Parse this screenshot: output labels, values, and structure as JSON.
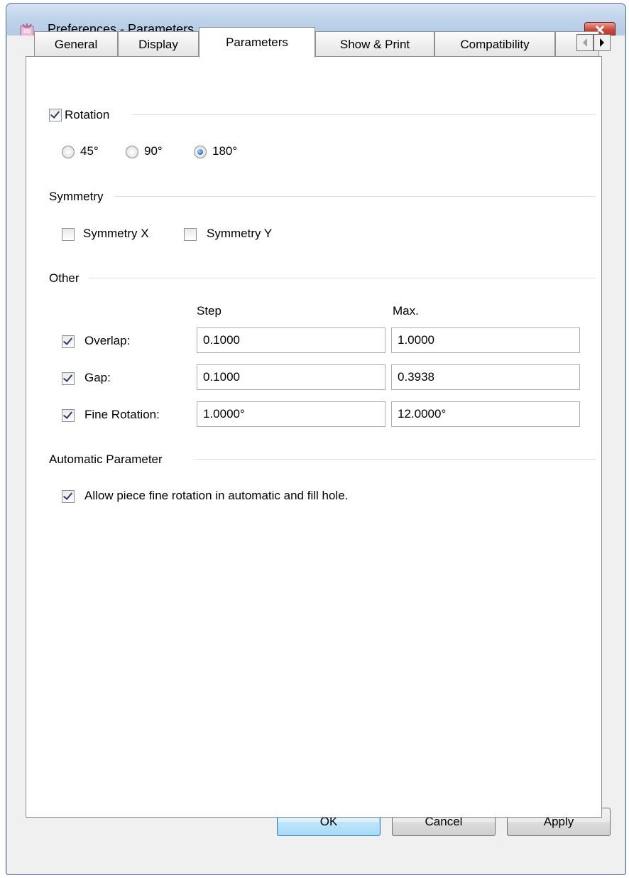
{
  "window": {
    "title": "Preferences - Parameters"
  },
  "tabs": [
    "General",
    "Display",
    "Parameters",
    "Show & Print",
    "Compatibility"
  ],
  "active_tab": "Parameters",
  "rotation": {
    "label": "Rotation",
    "checked": true,
    "options": [
      "45°",
      "90°",
      "180°"
    ],
    "selected": "180°"
  },
  "symmetry": {
    "label": "Symmetry",
    "x_label": "Symmetry X",
    "y_label": "Symmetry Y",
    "x_checked": false,
    "y_checked": false
  },
  "other": {
    "label": "Other",
    "step_header": "Step",
    "max_header": "Max.",
    "rows": [
      {
        "label": "Overlap:",
        "checked": true,
        "step": "0.1000",
        "max": "1.0000"
      },
      {
        "label": "Gap:",
        "checked": true,
        "step": "0.1000",
        "max": "0.3938"
      },
      {
        "label": "Fine Rotation:",
        "checked": true,
        "step": "1.0000°",
        "max": "12.0000°"
      }
    ]
  },
  "automatic": {
    "label": "Automatic Parameter",
    "option_label": "Allow piece fine rotation in automatic and fill hole.",
    "option_checked": true
  },
  "buttons": {
    "ok": "OK",
    "cancel": "Cancel",
    "apply": "Apply"
  }
}
